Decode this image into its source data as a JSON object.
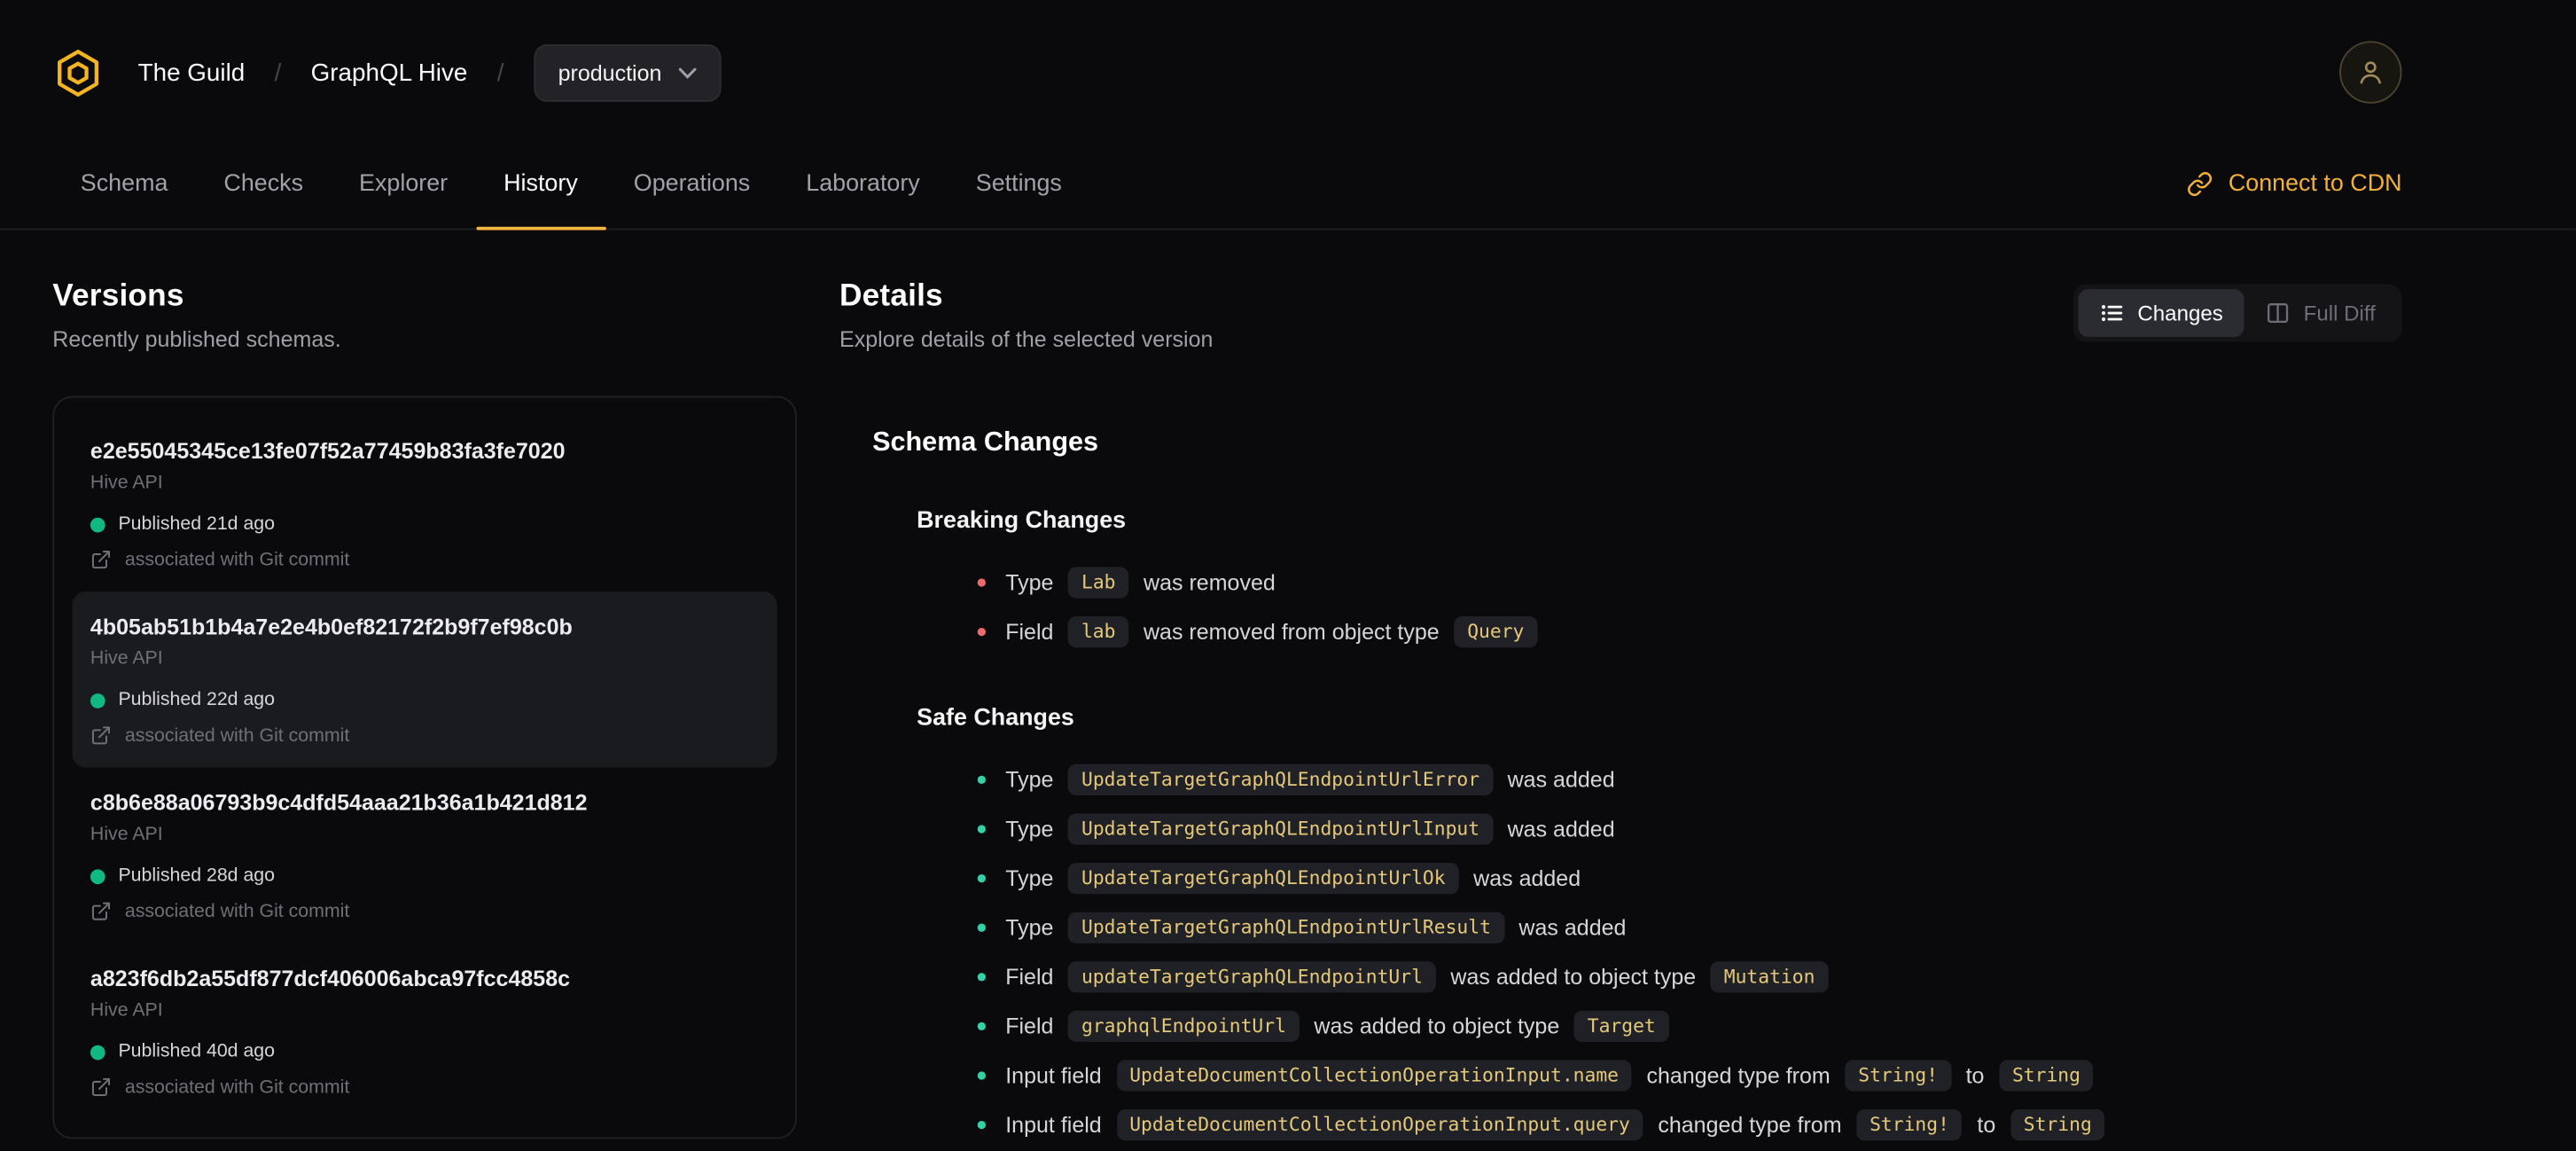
{
  "colors": {
    "accent": "#f4b740",
    "success": "#10b981",
    "danger": "#ef6a6a",
    "code_text": "#e5c878"
  },
  "header": {
    "org": "The Guild",
    "sep1": "/",
    "project": "GraphQL Hive",
    "sep2": "/",
    "environment": "production"
  },
  "nav": {
    "tabs": [
      {
        "label": "Schema"
      },
      {
        "label": "Checks"
      },
      {
        "label": "Explorer"
      },
      {
        "label": "History"
      },
      {
        "label": "Operations"
      },
      {
        "label": "Laboratory"
      },
      {
        "label": "Settings"
      }
    ],
    "active_tab": "History",
    "connect_cdn": "Connect to CDN"
  },
  "versions": {
    "title": "Versions",
    "subtitle": "Recently published schemas.",
    "items": [
      {
        "hash": "e2e55045345ce13fe07f52a77459b83fa3fe7020",
        "service": "Hive API",
        "published": "Published 21d ago",
        "git": "associated with Git commit",
        "selected": false
      },
      {
        "hash": "4b05ab51b1b4a7e2e4b0ef82172f2b9f7ef98c0b",
        "service": "Hive API",
        "published": "Published 22d ago",
        "git": "associated with Git commit",
        "selected": true
      },
      {
        "hash": "c8b6e88a06793b9c4dfd54aaa21b36a1b421d812",
        "service": "Hive API",
        "published": "Published 28d ago",
        "git": "associated with Git commit",
        "selected": false
      },
      {
        "hash": "a823f6db2a55df877dcf406006abca97fcc4858c",
        "service": "Hive API",
        "published": "Published 40d ago",
        "git": "associated with Git commit",
        "selected": false
      }
    ]
  },
  "details": {
    "title": "Details",
    "subtitle": "Explore details of the selected version",
    "toggle": {
      "changes": "Changes",
      "full_diff": "Full Diff"
    },
    "schema_changes_title": "Schema Changes",
    "breaking_title": "Breaking Changes",
    "safe_title": "Safe Changes",
    "breaking_items": [
      {
        "pre": "Type",
        "code": "Lab",
        "post": "was removed"
      },
      {
        "pre": "Field",
        "code": "lab",
        "mid": "was removed from object type",
        "code2": "Query"
      }
    ],
    "safe_items": [
      {
        "pre": "Type",
        "code": "UpdateTargetGraphQLEndpointUrlError",
        "post": "was added"
      },
      {
        "pre": "Type",
        "code": "UpdateTargetGraphQLEndpointUrlInput",
        "post": "was added"
      },
      {
        "pre": "Type",
        "code": "UpdateTargetGraphQLEndpointUrlOk",
        "post": "was added"
      },
      {
        "pre": "Type",
        "code": "UpdateTargetGraphQLEndpointUrlResult",
        "post": "was added"
      },
      {
        "pre": "Field",
        "code": "updateTargetGraphQLEndpointUrl",
        "mid": "was added to object type",
        "code2": "Mutation"
      },
      {
        "pre": "Field",
        "code": "graphqlEndpointUrl",
        "mid": "was added to object type",
        "code2": "Target"
      },
      {
        "pre": "Input field",
        "code": "UpdateDocumentCollectionOperationInput.name",
        "mid": "changed type from",
        "code2": "String!",
        "mid2": "to",
        "code3": "String"
      },
      {
        "pre": "Input field",
        "code": "UpdateDocumentCollectionOperationInput.query",
        "mid": "changed type from",
        "code2": "String!",
        "mid2": "to",
        "code3": "String"
      }
    ]
  }
}
